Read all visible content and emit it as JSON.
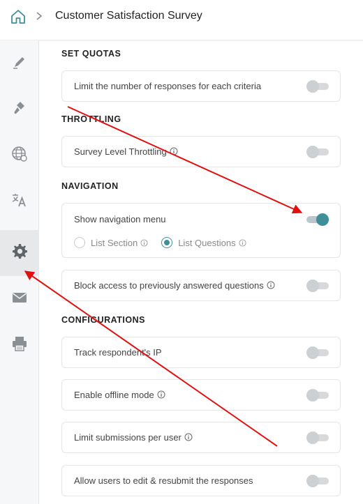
{
  "header": {
    "title": "Customer Satisfaction Survey",
    "home_icon": "home-icon",
    "separator_icon": "chevron-right-icon"
  },
  "sidebar": {
    "items": [
      {
        "icon": "pencil-icon",
        "active": false
      },
      {
        "icon": "paint-brush-icon",
        "active": false
      },
      {
        "icon": "globe-icon",
        "active": false
      },
      {
        "icon": "translate-icon",
        "active": false
      },
      {
        "icon": "gear-icon",
        "active": true
      },
      {
        "icon": "mail-icon",
        "active": false
      },
      {
        "icon": "printer-icon",
        "active": false
      }
    ]
  },
  "sections": {
    "quotas": {
      "title": "SET QUOTAS",
      "limit_responses": {
        "label": "Limit the number of responses for each criteria",
        "enabled": false
      }
    },
    "throttling": {
      "title": "THROTTLING",
      "survey_level": {
        "label": "Survey Level Throttling",
        "enabled": false,
        "has_info": true
      }
    },
    "navigation": {
      "title": "NAVIGATION",
      "show_menu": {
        "label": "Show navigation menu",
        "enabled": true
      },
      "options": [
        {
          "label": "List Section",
          "checked": false
        },
        {
          "label": "List Questions",
          "checked": true
        }
      ],
      "block_access": {
        "label": "Block access to previously answered questions",
        "enabled": false,
        "has_info": true
      }
    },
    "configurations": {
      "title": "CONFIGURATIONS",
      "track_ip": {
        "label": "Track respondent's IP",
        "enabled": false
      },
      "offline_mode": {
        "label": "Enable offline mode",
        "enabled": false,
        "has_info": true
      },
      "limit_submissions": {
        "label": "Limit submissions per user",
        "enabled": false,
        "has_info": true
      },
      "edit_resubmit": {
        "label": "Allow users to edit & resubmit the responses",
        "enabled": false
      }
    }
  },
  "colors": {
    "accent": "#3f8f9a",
    "annotation": "#e01010"
  }
}
